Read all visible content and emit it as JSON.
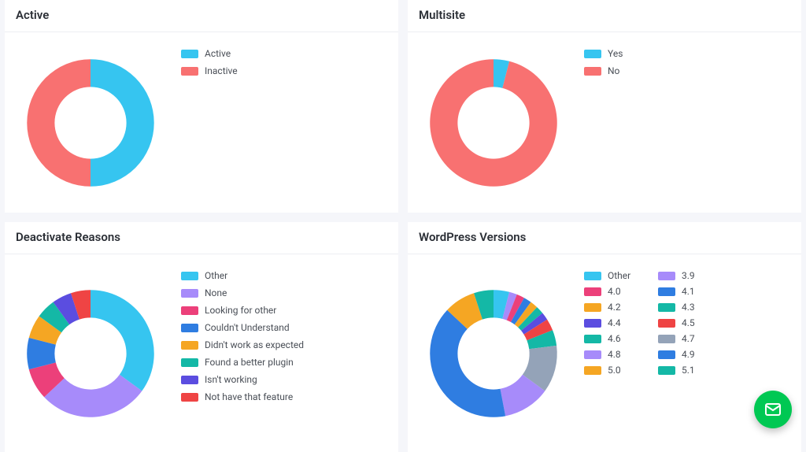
{
  "palette": {
    "cyan": "#36c5f0",
    "coral": "#f87171",
    "lilac": "#a78bfa",
    "pink": "#ec407a",
    "blue": "#2f7de1",
    "amber": "#f5a623",
    "teal": "#14b8a6",
    "indigo": "#5b4de0",
    "red": "#ef4444",
    "slate": "#94a3b8"
  },
  "cards": {
    "active": {
      "title": "Active",
      "legend_style": "single",
      "slices": [
        {
          "label": "Active",
          "value": 50,
          "colorKey": "cyan"
        },
        {
          "label": "Inactive",
          "value": 50,
          "colorKey": "coral"
        }
      ]
    },
    "multisite": {
      "title": "Multisite",
      "legend_style": "single",
      "slices": [
        {
          "label": "Yes",
          "value": 4,
          "colorKey": "cyan"
        },
        {
          "label": "No",
          "value": 96,
          "colorKey": "coral"
        }
      ]
    },
    "deactivate": {
      "title": "Deactivate Reasons",
      "legend_style": "single",
      "slices": [
        {
          "label": "Other",
          "value": 35,
          "colorKey": "cyan"
        },
        {
          "label": "None",
          "value": 28,
          "colorKey": "lilac"
        },
        {
          "label": "Looking for other",
          "value": 8,
          "colorKey": "pink"
        },
        {
          "label": "Couldn't Understand",
          "value": 8,
          "colorKey": "blue"
        },
        {
          "label": "Didn't work as expected",
          "value": 6,
          "colorKey": "amber"
        },
        {
          "label": "Found a better plugin",
          "value": 5,
          "colorKey": "teal"
        },
        {
          "label": "Isn't working",
          "value": 5,
          "colorKey": "indigo"
        },
        {
          "label": "Not have that feature",
          "value": 5,
          "colorKey": "red"
        }
      ]
    },
    "versions": {
      "title": "WordPress Versions",
      "legend_style": "two-col",
      "slices": [
        {
          "label": "Other",
          "value": 4,
          "colorKey": "cyan"
        },
        {
          "label": "3.9",
          "value": 2,
          "colorKey": "lilac"
        },
        {
          "label": "4.0",
          "value": 2,
          "colorKey": "pink"
        },
        {
          "label": "4.1",
          "value": 2,
          "colorKey": "blue"
        },
        {
          "label": "4.2",
          "value": 2,
          "colorKey": "amber"
        },
        {
          "label": "4.3",
          "value": 2,
          "colorKey": "teal"
        },
        {
          "label": "4.4",
          "value": 2,
          "colorKey": "indigo"
        },
        {
          "label": "4.5",
          "value": 3,
          "colorKey": "red"
        },
        {
          "label": "4.6",
          "value": 4,
          "colorKey": "teal"
        },
        {
          "label": "4.7",
          "value": 12,
          "colorKey": "slate"
        },
        {
          "label": "4.8",
          "value": 12,
          "colorKey": "lilac"
        },
        {
          "label": "4.9",
          "value": 40,
          "colorKey": "blue"
        },
        {
          "label": "5.0",
          "value": 8,
          "colorKey": "amber"
        },
        {
          "label": "5.1",
          "value": 5,
          "colorKey": "teal"
        }
      ]
    }
  },
  "chart_data": [
    {
      "type": "pie",
      "title": "Active",
      "categories": [
        "Active",
        "Inactive"
      ],
      "values": [
        50,
        50
      ]
    },
    {
      "type": "pie",
      "title": "Multisite",
      "categories": [
        "Yes",
        "No"
      ],
      "values": [
        4,
        96
      ]
    },
    {
      "type": "pie",
      "title": "Deactivate Reasons",
      "categories": [
        "Other",
        "None",
        "Looking for other",
        "Couldn't Understand",
        "Didn't work as expected",
        "Found a better plugin",
        "Isn't working",
        "Not have that feature"
      ],
      "values": [
        35,
        28,
        8,
        8,
        6,
        5,
        5,
        5
      ]
    },
    {
      "type": "pie",
      "title": "WordPress Versions",
      "categories": [
        "Other",
        "3.9",
        "4.0",
        "4.1",
        "4.2",
        "4.3",
        "4.4",
        "4.5",
        "4.6",
        "4.7",
        "4.8",
        "4.9",
        "5.0",
        "5.1"
      ],
      "values": [
        4,
        2,
        2,
        2,
        2,
        2,
        2,
        3,
        4,
        12,
        12,
        40,
        8,
        5
      ]
    }
  ]
}
